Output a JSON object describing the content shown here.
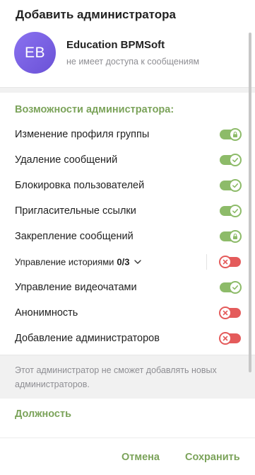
{
  "dialog": {
    "title": "Добавить администратора"
  },
  "profile": {
    "initials": "EB",
    "name": "Education BPMSoft",
    "status": "не имеет доступа к сообщениям"
  },
  "permissions": {
    "section_title": "Возможности администратора:",
    "items": [
      {
        "label": "Изменение профиля группы",
        "state": "on",
        "knob_icon": "lock-icon"
      },
      {
        "label": "Удаление сообщений",
        "state": "on",
        "knob_icon": "check-icon"
      },
      {
        "label": "Блокировка пользователей",
        "state": "on",
        "knob_icon": "check-icon"
      },
      {
        "label": "Пригласительные ссылки",
        "state": "on",
        "knob_icon": "check-icon"
      },
      {
        "label": "Закрепление сообщений",
        "state": "on",
        "knob_icon": "lock-icon"
      },
      {
        "label": "Управление историями",
        "count": "0/3",
        "state": "off",
        "knob_icon": "cross-icon"
      },
      {
        "label": "Управление видеочатами",
        "state": "on",
        "knob_icon": "check-icon"
      },
      {
        "label": "Анонимность",
        "state": "off",
        "knob_icon": "cross-icon"
      },
      {
        "label": "Добавление администраторов",
        "state": "off",
        "knob_icon": "cross-icon"
      }
    ]
  },
  "note": "Этот администратор не сможет добавлять новых администраторов.",
  "position_label": "Должность",
  "buttons": {
    "cancel": "Отмена",
    "save": "Сохранить"
  },
  "colors": {
    "accent": "#7ba35a",
    "toggle_on": "#8dbb69",
    "toggle_off": "#e45b5b",
    "avatar": "#7a60e4"
  }
}
